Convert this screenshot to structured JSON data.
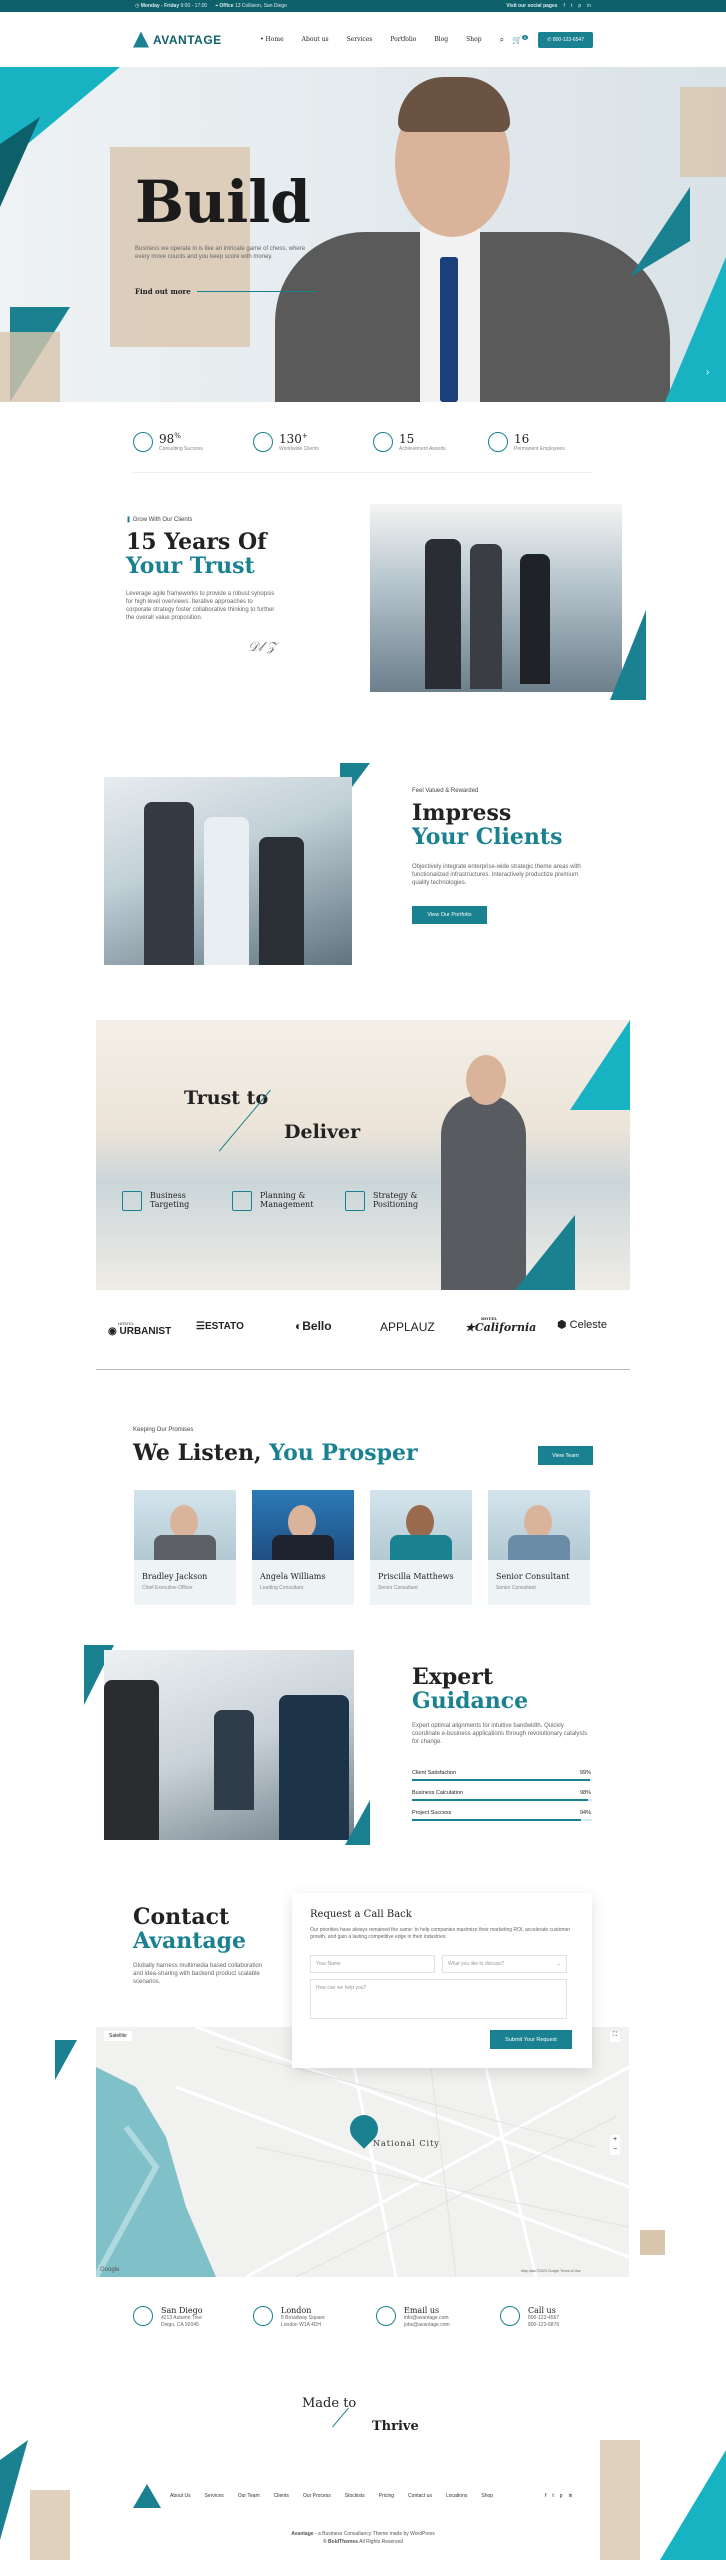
{
  "topbar": {
    "hours_label": "Monday - Friday",
    "hours": "9:00 - 17:00",
    "office_label": "Office",
    "office": "13 Collision, San Diego",
    "social_text": "Visit our social pages"
  },
  "header": {
    "brand": "AVANTAGE",
    "nav": [
      "Home",
      "About us",
      "Services",
      "Portfolio",
      "Blog",
      "Shop"
    ],
    "cart_count": "0",
    "phone": "800-123-6547"
  },
  "hero": {
    "title": "Build",
    "text": "Business we operate in is like an intricate game of chess, where every move counts and you keep score with money.",
    "link": "Find out more"
  },
  "stats": [
    {
      "num": "98",
      "sup": "%",
      "label": "Consulting Success"
    },
    {
      "num": "130",
      "sup": "+",
      "label": "Worldwide Clients"
    },
    {
      "num": "15",
      "sup": "",
      "label": "Achievement Awards"
    },
    {
      "num": "16",
      "sup": "",
      "label": "Permanent Employees"
    }
  ],
  "trust": {
    "kicker": "Grow With Our Clients",
    "title1": "15 Years Of",
    "title2": "Your Trust",
    "text": "Leverage agile frameworks to provide a robust synopsis for high level overviews. Iterative approaches to corporate strategy foster collaborative thinking to further the overall value proposition."
  },
  "impress": {
    "kicker": "Feel Valued & Rewarded",
    "title1": "Impress",
    "title2": "Your Clients",
    "text": "Objectively integrate enterprise-wide strategic theme areas with functionalized infrastructures. Interactively productize premium quality technologies.",
    "button": "View Our Portfolio"
  },
  "deliver": {
    "word1": "Trust to",
    "word2": "Deliver",
    "items": [
      {
        "l1": "Business",
        "l2": "Targeting"
      },
      {
        "l1": "Planning &",
        "l2": "Management"
      },
      {
        "l1": "Strategy &",
        "l2": "Positioning"
      }
    ]
  },
  "clients": [
    "URBANIST",
    "ESTATO",
    "Bello",
    "APPLAUZ",
    "California",
    "Celeste"
  ],
  "clients_sub": {
    "urbanist": "HOSTEL",
    "california": "HOTEL"
  },
  "team": {
    "kicker": "Keeping Our Promises",
    "title1": "We Listen,",
    "title2": "You Prosper",
    "button": "View Team",
    "members": [
      {
        "name": "Bradley Jackson",
        "role": "Chief Executive Officer"
      },
      {
        "name": "Angela Williams",
        "role": "Leading Consultant"
      },
      {
        "name": "Priscilla Matthews",
        "role": "Senior Consultant"
      },
      {
        "name": "Senior Consultant",
        "role": "Senior Consultant"
      }
    ]
  },
  "guidance": {
    "title1": "Expert",
    "title2": "Guidance",
    "text": "Expert optimal alignments for intuitive bandwidth. Quickly coordinate e-business applications through revolutionary catalysts for change.",
    "bars": [
      {
        "label": "Client Satisfaction",
        "value": 99,
        "text": "99%"
      },
      {
        "label": "Business Calculation",
        "value": 98,
        "text": "98%"
      },
      {
        "label": "Project Success",
        "value": 94,
        "text": "94%"
      }
    ]
  },
  "contact": {
    "title1": "Contact",
    "title2": "Avantage",
    "text": "Globally harness multimedia based collaboration and idea-sharing with backend product scalable scenarios.",
    "form_title": "Request a Call Back",
    "form_text": "Our priorities have always remained the same: to help companies maximize their marketing ROI, accelerate customer growth, and gain a lasting competitive edge in their industries.",
    "name_ph": "Your Name",
    "topic_ph": "What you like to discuss?",
    "message_ph": "How can we help you?",
    "submit": "Submit Your Request"
  },
  "map": {
    "tab": "Satellite",
    "city": "National City",
    "google": "Google",
    "credits": "Map data ©2023 Google   Terms of Use"
  },
  "contacts": [
    {
      "title": "San Diego",
      "l1": "4213 Autumn Tree",
      "l2": "Diego, CA 92045"
    },
    {
      "title": "London",
      "l1": "8 Broadway Square",
      "l2": "London W1A 4DH"
    },
    {
      "title": "Email us",
      "l1": "info@avantage.com",
      "l2": "jobs@avantage.com"
    },
    {
      "title": "Call us",
      "l1": "800-123-4567",
      "l2": "800-123-6876"
    }
  ],
  "made": {
    "l1": "Made to",
    "l2": "Thrive"
  },
  "footer": {
    "nav": [
      "About Us",
      "Services",
      "Our Team",
      "Clients",
      "Our Process",
      "Stockists",
      "Pricing",
      "Contact us",
      "Locations",
      "Shop"
    ],
    "copy1": "Avantage",
    "copy1b": " - a Business Consultancy Theme made by WordPress",
    "copy2": "© BoldThemes",
    "copy2b": " All Rights Reserved"
  },
  "colors": {
    "accent": "#1a8190",
    "dark_accent": "#0d5f6a",
    "beige": "#d8c5ae"
  }
}
